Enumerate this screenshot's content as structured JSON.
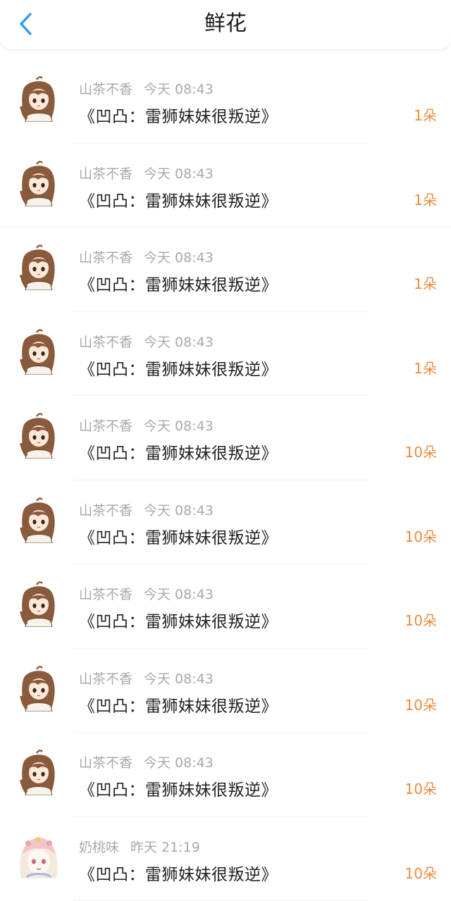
{
  "header": {
    "title": "鲜花",
    "back_icon": "chevron-left-icon",
    "accent": "#2e9bf0"
  },
  "colors": {
    "count": "#f08a3c",
    "meta": "#a9a9a9",
    "text": "#222222"
  },
  "records": [
    {
      "user": "山茶不香",
      "time": "今天 08:43",
      "book": "《凹凸：雷狮妹妹很叛逆》",
      "count": "1朵",
      "avatar": "brown-hair-girl"
    },
    {
      "user": "山茶不香",
      "time": "今天 08:43",
      "book": "《凹凸：雷狮妹妹很叛逆》",
      "count": "1朵",
      "avatar": "brown-hair-girl"
    },
    {
      "user": "山茶不香",
      "time": "今天 08:43",
      "book": "《凹凸：雷狮妹妹很叛逆》",
      "count": "1朵",
      "avatar": "brown-hair-girl"
    },
    {
      "user": "山茶不香",
      "time": "今天 08:43",
      "book": "《凹凸：雷狮妹妹很叛逆》",
      "count": "1朵",
      "avatar": "brown-hair-girl"
    },
    {
      "user": "山茶不香",
      "time": "今天 08:43",
      "book": "《凹凸：雷狮妹妹很叛逆》",
      "count": "10朵",
      "avatar": "brown-hair-girl"
    },
    {
      "user": "山茶不香",
      "time": "今天 08:43",
      "book": "《凹凸：雷狮妹妹很叛逆》",
      "count": "10朵",
      "avatar": "brown-hair-girl"
    },
    {
      "user": "山茶不香",
      "time": "今天 08:43",
      "book": "《凹凸：雷狮妹妹很叛逆》",
      "count": "10朵",
      "avatar": "brown-hair-girl"
    },
    {
      "user": "山茶不香",
      "time": "今天 08:43",
      "book": "《凹凸：雷狮妹妹很叛逆》",
      "count": "10朵",
      "avatar": "brown-hair-girl"
    },
    {
      "user": "山茶不香",
      "time": "今天 08:43",
      "book": "《凹凸：雷狮妹妹很叛逆》",
      "count": "10朵",
      "avatar": "brown-hair-girl"
    },
    {
      "user": "奶桃味",
      "time": "昨天 21:19",
      "book": "《凹凸：雷狮妹妹很叛逆》",
      "count": "10朵",
      "avatar": "pastel-hair-girl"
    }
  ]
}
